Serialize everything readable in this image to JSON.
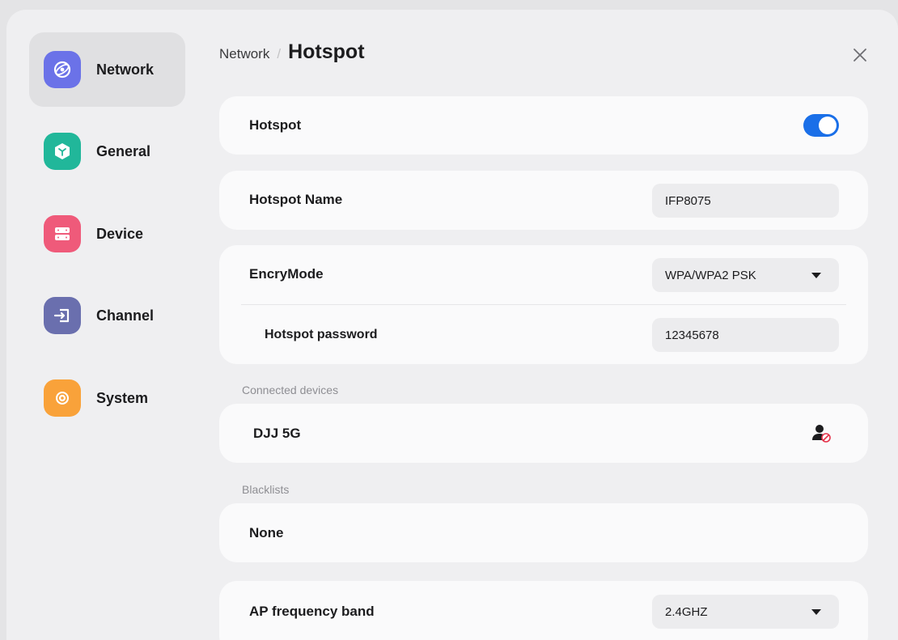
{
  "sidebar": {
    "items": [
      {
        "label": "Network",
        "icon": "globe-icon",
        "color": "#6b72e8",
        "active": true
      },
      {
        "label": "General",
        "icon": "cube-icon",
        "color": "#21b79a"
      },
      {
        "label": "Device",
        "icon": "device-icon",
        "color": "#ef5a7a"
      },
      {
        "label": "Channel",
        "icon": "input-icon",
        "color": "#6a6fae"
      },
      {
        "label": "System",
        "icon": "gear-icon",
        "color": "#f9a23a"
      }
    ]
  },
  "header": {
    "parent": "Network",
    "separator": "/",
    "title": "Hotspot"
  },
  "hotspot": {
    "label": "Hotspot",
    "enabled": true,
    "toggle_color": "#1a6fe8"
  },
  "hotspot_name": {
    "label": "Hotspot Name",
    "value": "IFP8075"
  },
  "encryption": {
    "label": "EncryMode",
    "value": "WPA/WPA2 PSK",
    "password_label": "Hotspot password",
    "password_value": "12345678"
  },
  "connected": {
    "section_label": "Connected devices",
    "devices": [
      {
        "name": "DJJ 5G",
        "action_icon": "block-user-icon"
      }
    ]
  },
  "blacklists": {
    "section_label": "Blacklists",
    "value": "None"
  },
  "ap_band": {
    "label": "AP frequency band",
    "value": "2.4GHZ"
  }
}
